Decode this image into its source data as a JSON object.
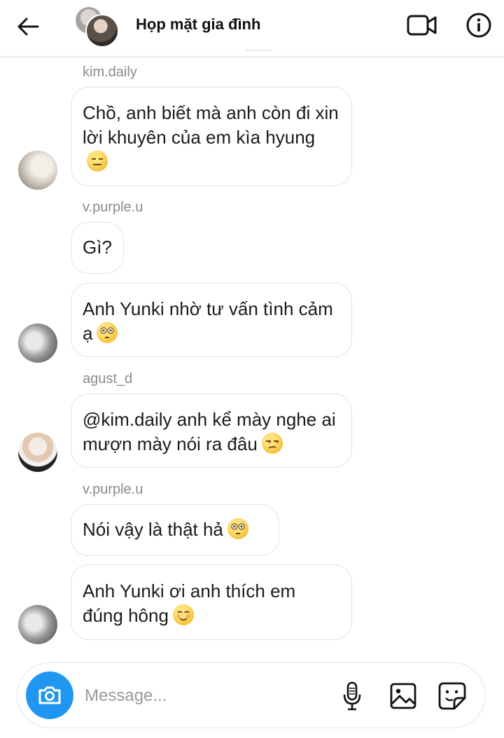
{
  "header": {
    "title": "Họp mặt gia đình",
    "icons": {
      "back": "arrow-left-icon",
      "video": "video-camera-icon",
      "info": "info-icon"
    }
  },
  "messages": [
    {
      "sender": "kim.daily",
      "text": "Chồ, anh biết mà anh còn đi xin lời khuyên của em kìa hyung",
      "emoji": "expressionless-face"
    },
    {
      "sender": "v.purple.u",
      "text": "Gì?",
      "emoji": ""
    },
    {
      "sender": "",
      "text": "Anh Yunki nhờ tư vấn tình cảm ạ",
      "emoji": "flushed-face"
    },
    {
      "sender": "agust_d",
      "text": "@kim.daily anh kể mày nghe ai mượn mày nói ra đâu",
      "emoji": "unamused-face"
    },
    {
      "sender": "v.purple.u",
      "text": "Nói vậy là thật hả",
      "emoji": "flushed-face"
    },
    {
      "sender": "",
      "text": "Anh Yunki ơi anh thích em đúng hông",
      "emoji": "smiling-face"
    }
  ],
  "composer": {
    "placeholder": "Message...",
    "icons": {
      "camera": "camera-icon",
      "mic": "microphone-icon",
      "gallery": "image-icon",
      "sticker": "sticker-icon"
    },
    "camera_color": "#1f97f0"
  }
}
